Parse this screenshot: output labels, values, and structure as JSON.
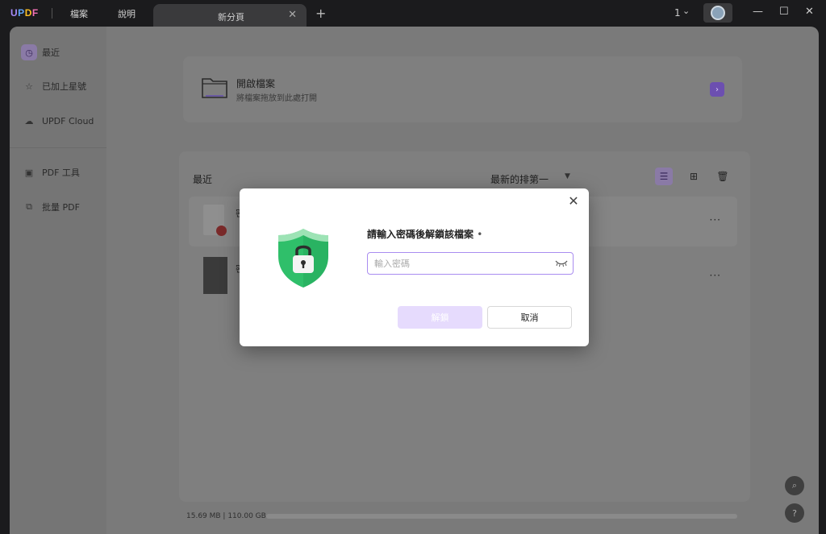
{
  "app": {
    "logo": "UPDF",
    "menu": [
      "檔案",
      "說明"
    ],
    "tab_title": "新分頁",
    "window_count": "1"
  },
  "sidebar": {
    "items": [
      {
        "label": "最近",
        "icon": "clock-icon"
      },
      {
        "label": "已加上星號",
        "icon": "star-icon"
      },
      {
        "label": "UPDF Cloud",
        "icon": "cloud-icon"
      },
      {
        "label": "PDF 工具",
        "icon": "toolbox-icon"
      },
      {
        "label": "批量 PDF",
        "icon": "batch-icon"
      }
    ]
  },
  "open_file": {
    "title": "開啟檔案",
    "subtitle": "將檔案拖放到此處打開",
    "arrow": "›"
  },
  "recent": {
    "title": "最近",
    "sort": "最新的排第一",
    "files": [
      {
        "name": "密",
        "locked": true
      },
      {
        "name": "密",
        "locked": false
      }
    ],
    "more": "···"
  },
  "storage": {
    "text": "15.69 MB | 110.00 GB"
  },
  "modal": {
    "title": "請輸入密碼後解鎖該檔案",
    "required_mark": "•",
    "password_placeholder": "輸入密碼",
    "password_value": "",
    "unlock_label": "解鎖",
    "cancel_label": "取消",
    "close": "✕"
  },
  "colors": {
    "accent": "#a98cf0",
    "unlock_bg": "#e6dbfd",
    "shield_green": "#2fbf6a"
  }
}
